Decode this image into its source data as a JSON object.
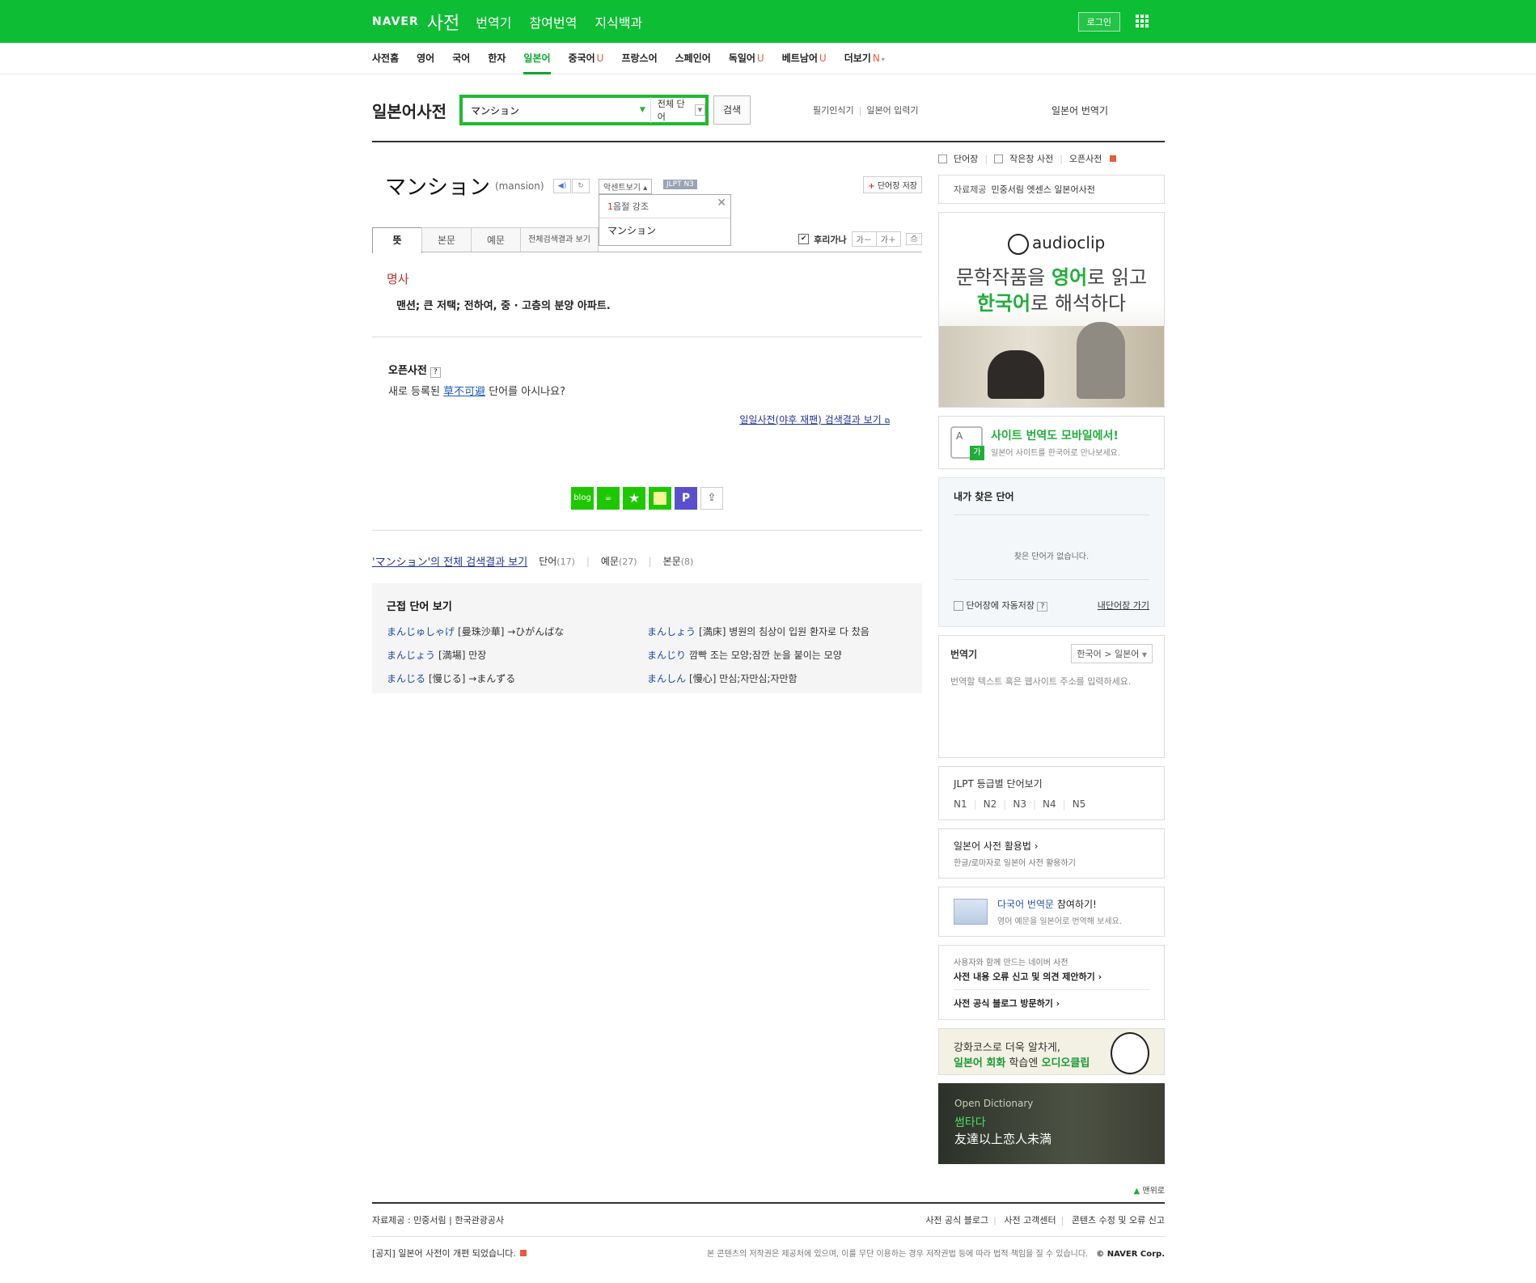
{
  "gnb": {
    "logo": "NAVER",
    "service": "사전",
    "links": [
      "번역기",
      "참여번역",
      "지식백과"
    ],
    "login": "로그인"
  },
  "lnb": {
    "items": [
      "사전홈",
      "영어",
      "국어",
      "한자",
      "일본어",
      "중국어",
      "프랑스어",
      "스페인어",
      "독일어",
      "베트남어",
      "더보기"
    ],
    "badges": {
      "cn": "U",
      "de": "U",
      "vi": "U",
      "more": "N"
    }
  },
  "search": {
    "dict_title": "일본어사전",
    "query": "マンション",
    "scope": "전체 단어",
    "button": "검색",
    "tool1": "필기인식기",
    "tool2": "일본어 입력기",
    "translator_link": "일본어 번역기"
  },
  "entry": {
    "word": "マンション",
    "orig": "(mansion)",
    "accent_btn": "악센트보기",
    "jlpt": "JLPT N3",
    "save": "단어장 저장",
    "accent_pop_row1_num": "1",
    "accent_pop_row1": "음절 강조",
    "accent_pop_row2": "マンション",
    "tabs": [
      "뜻",
      "본문",
      "예문",
      "전체검색결과 보기"
    ],
    "furigana": "후리가나",
    "font_minus": "가－",
    "font_plus": "가＋",
    "pos": "명사",
    "definition": "맨션; 큰 저택; 전하여, 중 · 고층의 분양 아파트."
  },
  "open_dict": {
    "title": "오픈사전",
    "q": "?",
    "text_before": "새로 등록된 ",
    "word": "草不可避",
    "text_after": " 단어를 아시나요?",
    "yahoo": "일일사전(야후 재팬) 검색결과 보기"
  },
  "share_icons": [
    "blog",
    "cafe",
    "star",
    "memo",
    "post",
    "share"
  ],
  "results": {
    "main_link": "'マンション'의 전체 검색결과 보기",
    "word_label": "단어",
    "word_count": "(17)",
    "ex_label": "예문",
    "ex_count": "(27)",
    "body_label": "본문",
    "body_count": "(8)"
  },
  "near": {
    "title": "근접 단어 보기",
    "items": [
      {
        "kana": "まんじゅしゃげ",
        "rest": "[曼珠沙華] →ひがんばな"
      },
      {
        "kana": "まんしょう",
        "rest": "[満床] 병원의 침상이 입원 환자로 다 찼음"
      },
      {
        "kana": "まんじょう",
        "rest": "[満場] 만장"
      },
      {
        "kana": "まんじり",
        "rest": "깜빡 조는 모양;잠깐 눈을 붙이는 모양"
      },
      {
        "kana": "まんじる",
        "rest": "[慢じる] →まんずる"
      },
      {
        "kana": "まんしん",
        "rest": "[慢心] 만심;자만심;자만함"
      }
    ]
  },
  "aside": {
    "top": [
      "단어장",
      "작은창 사전",
      "오픈사전"
    ],
    "src_label": "자료제공",
    "src_value": "민중서림 엣센스 일본어사전",
    "audio_logo": "audioclip",
    "audio_l1a": "문학작품을 ",
    "audio_l1b": "영어",
    "audio_l1c": "로 읽고",
    "audio_l2a": "한국어",
    "audio_l2b": "로 해석하다",
    "mobile_icon": "A",
    "mobile_icon_g": "가",
    "mobile_t1": "사이트 번역도 모바일에서!",
    "mobile_t2": "일본어 사이트를 한국어로 만나보세요.",
    "found_title": "내가 찾은 단어",
    "found_empty": "찾은 단어가 없습니다.",
    "found_auto": "단어장에 자동저장",
    "found_q": "?",
    "found_link": "내단어장 가기",
    "trans_title": "번역기",
    "trans_sel": "한국어 > 일본어",
    "trans_ph": "번역할 텍스트 혹은 웹사이트 주소를 입력하세요.",
    "jlpt_title": "JLPT 등급별 단어보기",
    "jlpt_levels": [
      "N1",
      "N2",
      "N3",
      "N4",
      "N5"
    ],
    "use_t1": "일본어 사전 활용법 ›",
    "use_t2": "한글/로마자로 일본어 사전 활용하기",
    "multi_t1a": "다국어 번역문 ",
    "multi_t1b": "참여하기!",
    "multi_t2": "영어 예문을 일본어로 번역해 보세요.",
    "report_t0": "사용자와 함께 만드는 네이버 사전",
    "report_t1": "사전 내용 오류 신고 및 의견 제안하기 ›",
    "report_t2": "사전 공식 블로그 방문하기 ›",
    "ban2_t1": "강화코스로 더욱 알차게,",
    "ban2_t2a": "일본어 회화",
    "ban2_t2b": " 학습엔 ",
    "ban2_t2c": "오디오클립",
    "ban3_od": "Open Dictionary",
    "ban3_ssum": "썸타다",
    "ban3_jp": "友達以上恋人未満"
  },
  "footer": {
    "top": "맨위로",
    "source": "자료제공 : 민중서림  |  한국관광공사",
    "links": [
      "사전 공식 블로그",
      "사전 고객센터",
      "콘텐츠 수정 및 오류 신고"
    ],
    "notice": "[공지] 일본어 사전이 개편 되었습니다.",
    "copy": "본 콘텐츠의 저작권은 제공처에 있으며, 이를 무단 이용하는 경우 저작권법 등에 따라 법적 책임을 질 수 있습니다.",
    "corp": "© NAVER Corp."
  },
  "colors": {
    "brand": "#0dbd34",
    "accent": "#0aa82b",
    "pos": "#b7322b"
  }
}
